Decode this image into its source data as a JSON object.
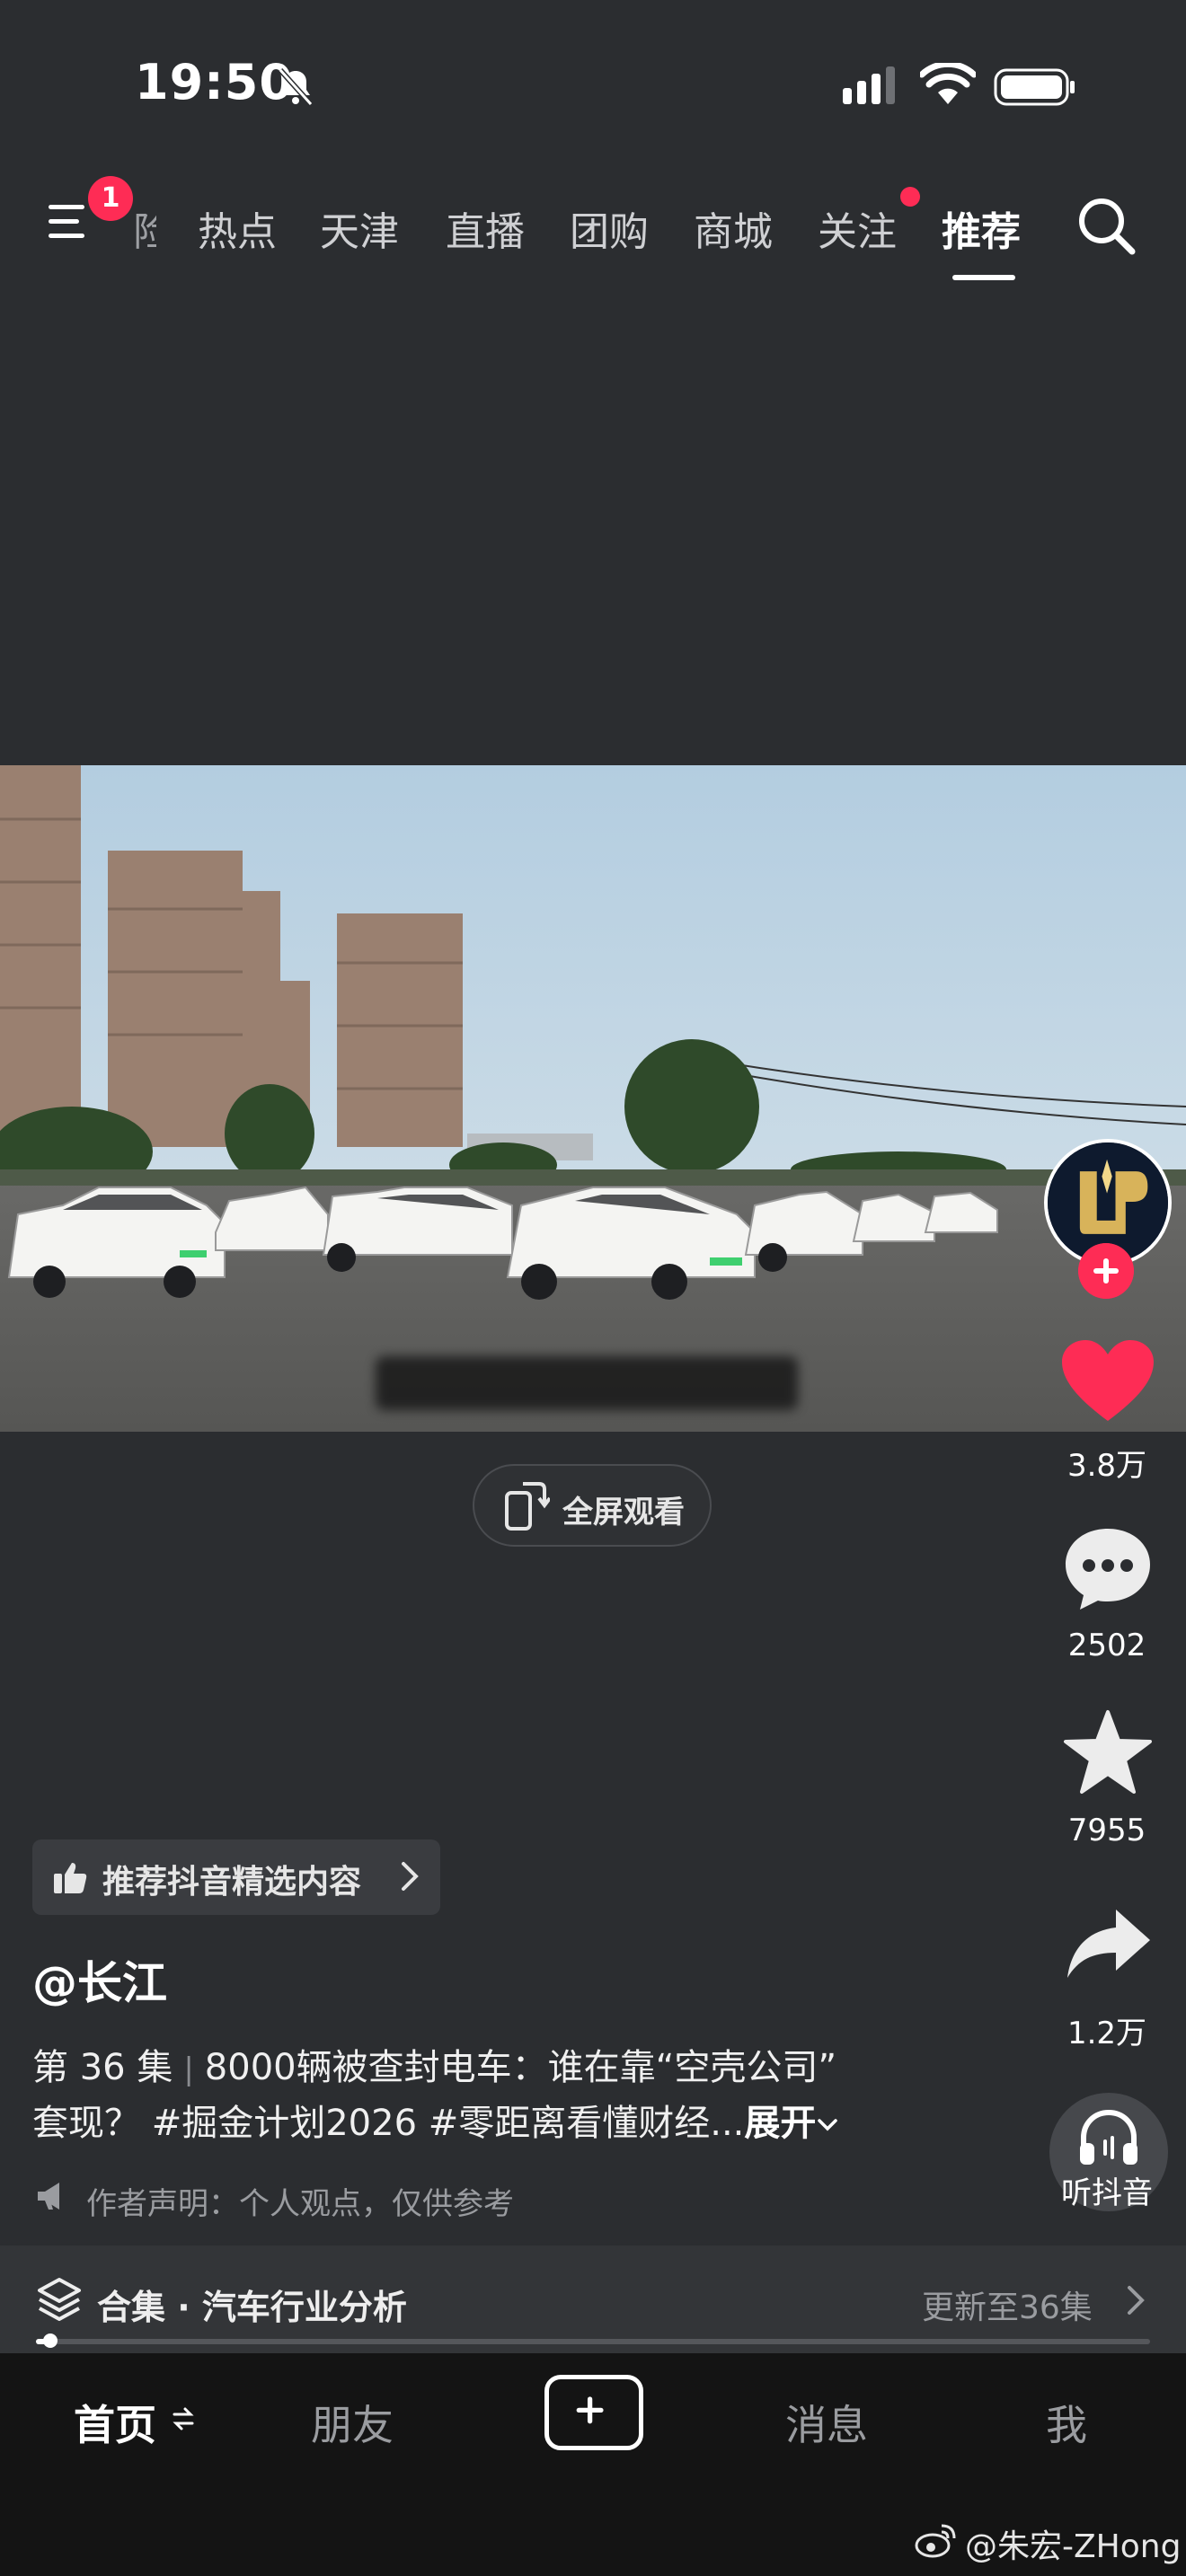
{
  "status_bar": {
    "time": "19:50",
    "icons": [
      "bell-muted-icon",
      "signal-icon",
      "wifi-icon",
      "battery-icon"
    ]
  },
  "top_nav": {
    "menu_badge": "1",
    "clipped_tab": "险",
    "tabs": [
      "热点",
      "天津",
      "直播",
      "团购",
      "商城",
      "关注",
      "推荐"
    ],
    "active_tab": "推荐",
    "accent_color": "#fe2c55"
  },
  "video": {
    "fullscreen_label": "全屏观看"
  },
  "actions": {
    "likes": "3.8万",
    "comments": "2502",
    "favorites": "7955",
    "shares": "1.2万",
    "listen_label": "听抖音"
  },
  "info": {
    "promo_label": "推荐抖音精选内容",
    "author": "@长江",
    "episode": "第 36 集",
    "title_line1": "8000辆被查封电车：谁在靠“空壳公司”",
    "title_line2": "套现？ #掘金计划2026 #零距离看懂财经...",
    "expand_label": "展开",
    "disclaimer": "作者声明：个人观点，仅供参考"
  },
  "collection": {
    "label": "合集 · 汽车行业分析",
    "update": "更新至36集",
    "progress": 0.01
  },
  "bottom_nav": {
    "home": "首页",
    "friends": "朋友",
    "messages": "消息",
    "me": "我"
  },
  "watermark": "@朱宏-ZHong"
}
